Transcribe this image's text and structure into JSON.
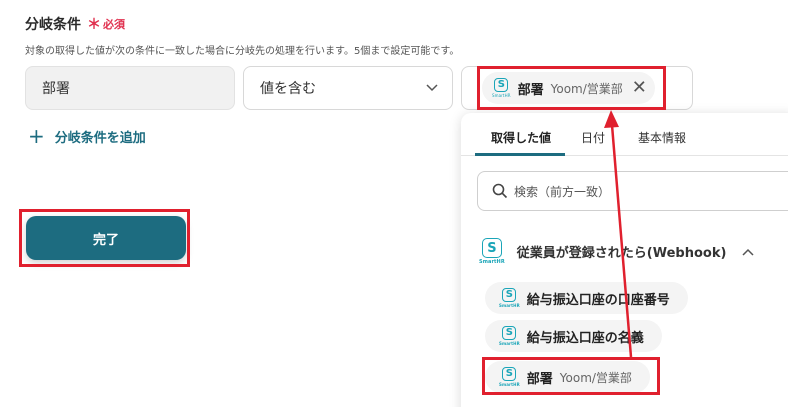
{
  "section": {
    "title": "分岐条件",
    "required_star": "＊",
    "required_text": "必須",
    "description": "対象の取得した値が次の条件に一致した場合に分岐先の処理を行います。5個まで設定可能です。"
  },
  "condition": {
    "field": "部署",
    "operator": "値を含む",
    "value_chip": {
      "label": "部署",
      "sub": "Yoom/営業部",
      "icon": "smarthr-icon"
    }
  },
  "add_condition_label": "分岐条件を追加",
  "done_label": "完了",
  "popup": {
    "tabs": [
      "取得した値",
      "日付",
      "基本情報"
    ],
    "active_tab": 0,
    "search_placeholder": "検索（前方一致）",
    "group": {
      "title": "従業員が登録されたら(Webhook)",
      "icon": "smarthr-icon",
      "expanded": true
    },
    "items": [
      {
        "label": "給与振込口座の口座番号",
        "sub": ""
      },
      {
        "label": "給与振込口座の名義",
        "sub": ""
      },
      {
        "label": "部署",
        "sub": "Yoom/営業部"
      }
    ]
  },
  "logo_text": "SmartHR",
  "colors": {
    "accent": "#1d6c80",
    "required": "#e0304e",
    "highlight": "#e0202e",
    "logo": "#1aa5b8"
  }
}
